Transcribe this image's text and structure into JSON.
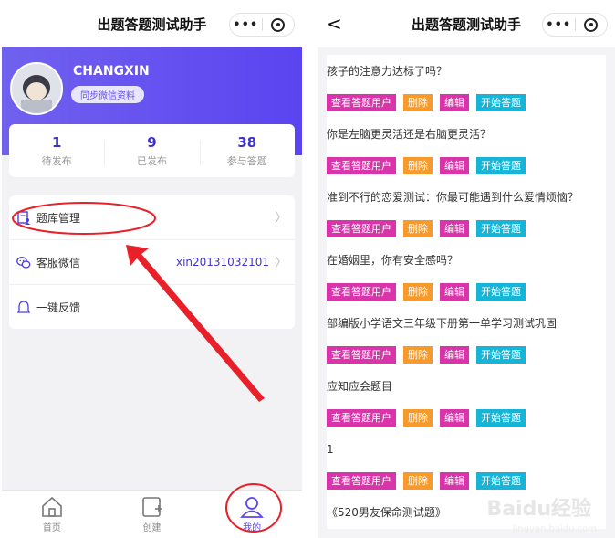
{
  "app_title": "出题答题测试助手",
  "capsule": {
    "more_icon": "dots-icon",
    "close_icon": "target-icon"
  },
  "profile": {
    "username": "CHANGXIN",
    "sync_label": "同步微信资料"
  },
  "stats": [
    {
      "value": "1",
      "label": "待发布"
    },
    {
      "value": "9",
      "label": "已发布"
    },
    {
      "value": "38",
      "label": "参与答题"
    }
  ],
  "menu": {
    "bank": {
      "label": "题库管理",
      "icon": "question-bank-icon"
    },
    "wechat": {
      "label": "客服微信",
      "value": "xin20131032101",
      "icon": "wechat-icon"
    },
    "feedback": {
      "label": "一键反馈",
      "icon": "feedback-icon"
    }
  },
  "tabs": [
    {
      "label": "首页",
      "icon": "home-icon"
    },
    {
      "label": "创建",
      "icon": "create-icon"
    },
    {
      "label": "我的",
      "icon": "profile-icon"
    }
  ],
  "buttons": {
    "view": "查看答题用户",
    "delete": "删除",
    "edit": "编辑",
    "start": "开始答题"
  },
  "quizzes": [
    "孩子的注意力达标了吗？",
    "你是左脑更灵活还是右脑更灵活？",
    "准到不行的恋爱测试：你最可能遇到什么爱情烦恼？",
    "在婚姻里，你有安全感吗？",
    "部编版小学语文三年级下册第一单学习测试巩固",
    "应知应会题目",
    "1",
    "《520男友保命测试题》"
  ],
  "watermark": {
    "main": "Baidu经验",
    "sub": "jingyan.baidu.com"
  },
  "colors": {
    "accent": "#5a44f0",
    "view_button": "#d934a9",
    "delete_button": "#f79a2c",
    "start_button": "#16b4d6",
    "annotation": "#e8202a"
  }
}
